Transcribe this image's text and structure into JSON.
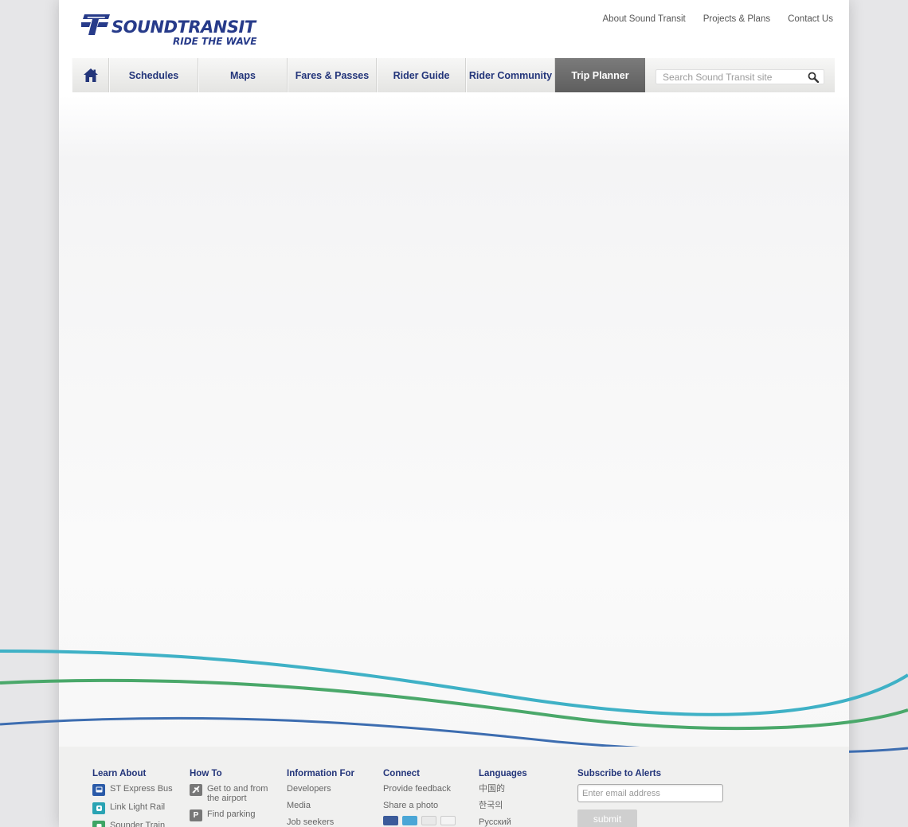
{
  "header": {
    "brand": "SOUNDTRANSIT",
    "tagline": "RIDE THE WAVE",
    "top_links": [
      "About Sound Transit",
      "Projects & Plans",
      "Contact Us"
    ]
  },
  "nav": {
    "home_icon": "home-icon",
    "items": [
      "Schedules",
      "Maps",
      "Fares & Passes",
      "Rider Guide",
      "Rider Community"
    ],
    "active": "Trip Planner",
    "search_placeholder": "Search Sound Transit site",
    "search_icon": "magnifier-icon"
  },
  "colors": {
    "brand_blue": "#273b8a",
    "wave_teal": "#3fb1c6",
    "wave_green": "#4aa86a",
    "wave_blue": "#3d6db0"
  },
  "footer": {
    "learn_about": {
      "title": "Learn About",
      "links": [
        {
          "label": "ST Express Bus",
          "icon": "bus-icon",
          "color": "#2a5aa8"
        },
        {
          "label": "Link Light Rail",
          "icon": "light-rail-icon",
          "color": "#2aa3b3"
        },
        {
          "label": "Sounder Train",
          "icon": "train-icon",
          "color": "#3ea565"
        }
      ]
    },
    "how_to": {
      "title": "How To",
      "links": [
        {
          "label": "Get to and from the airport",
          "icon": "airplane-icon"
        },
        {
          "label": "Find parking",
          "icon": "parking-icon"
        }
      ]
    },
    "information_for": {
      "title": "Information For",
      "links": [
        "Developers",
        "Media",
        "Job seekers"
      ]
    },
    "connect": {
      "title": "Connect",
      "links": [
        "Provide feedback",
        "Share a photo"
      ],
      "social": [
        "facebook-icon",
        "twitter-icon",
        "youtube-icon",
        "email-icon"
      ]
    },
    "languages": {
      "title": "Languages",
      "links": [
        "中国的",
        "한국의",
        "Русский"
      ]
    },
    "subscribe": {
      "title": "Subscribe to Alerts",
      "email_placeholder": "Enter email address",
      "submit_label": "submit"
    }
  }
}
